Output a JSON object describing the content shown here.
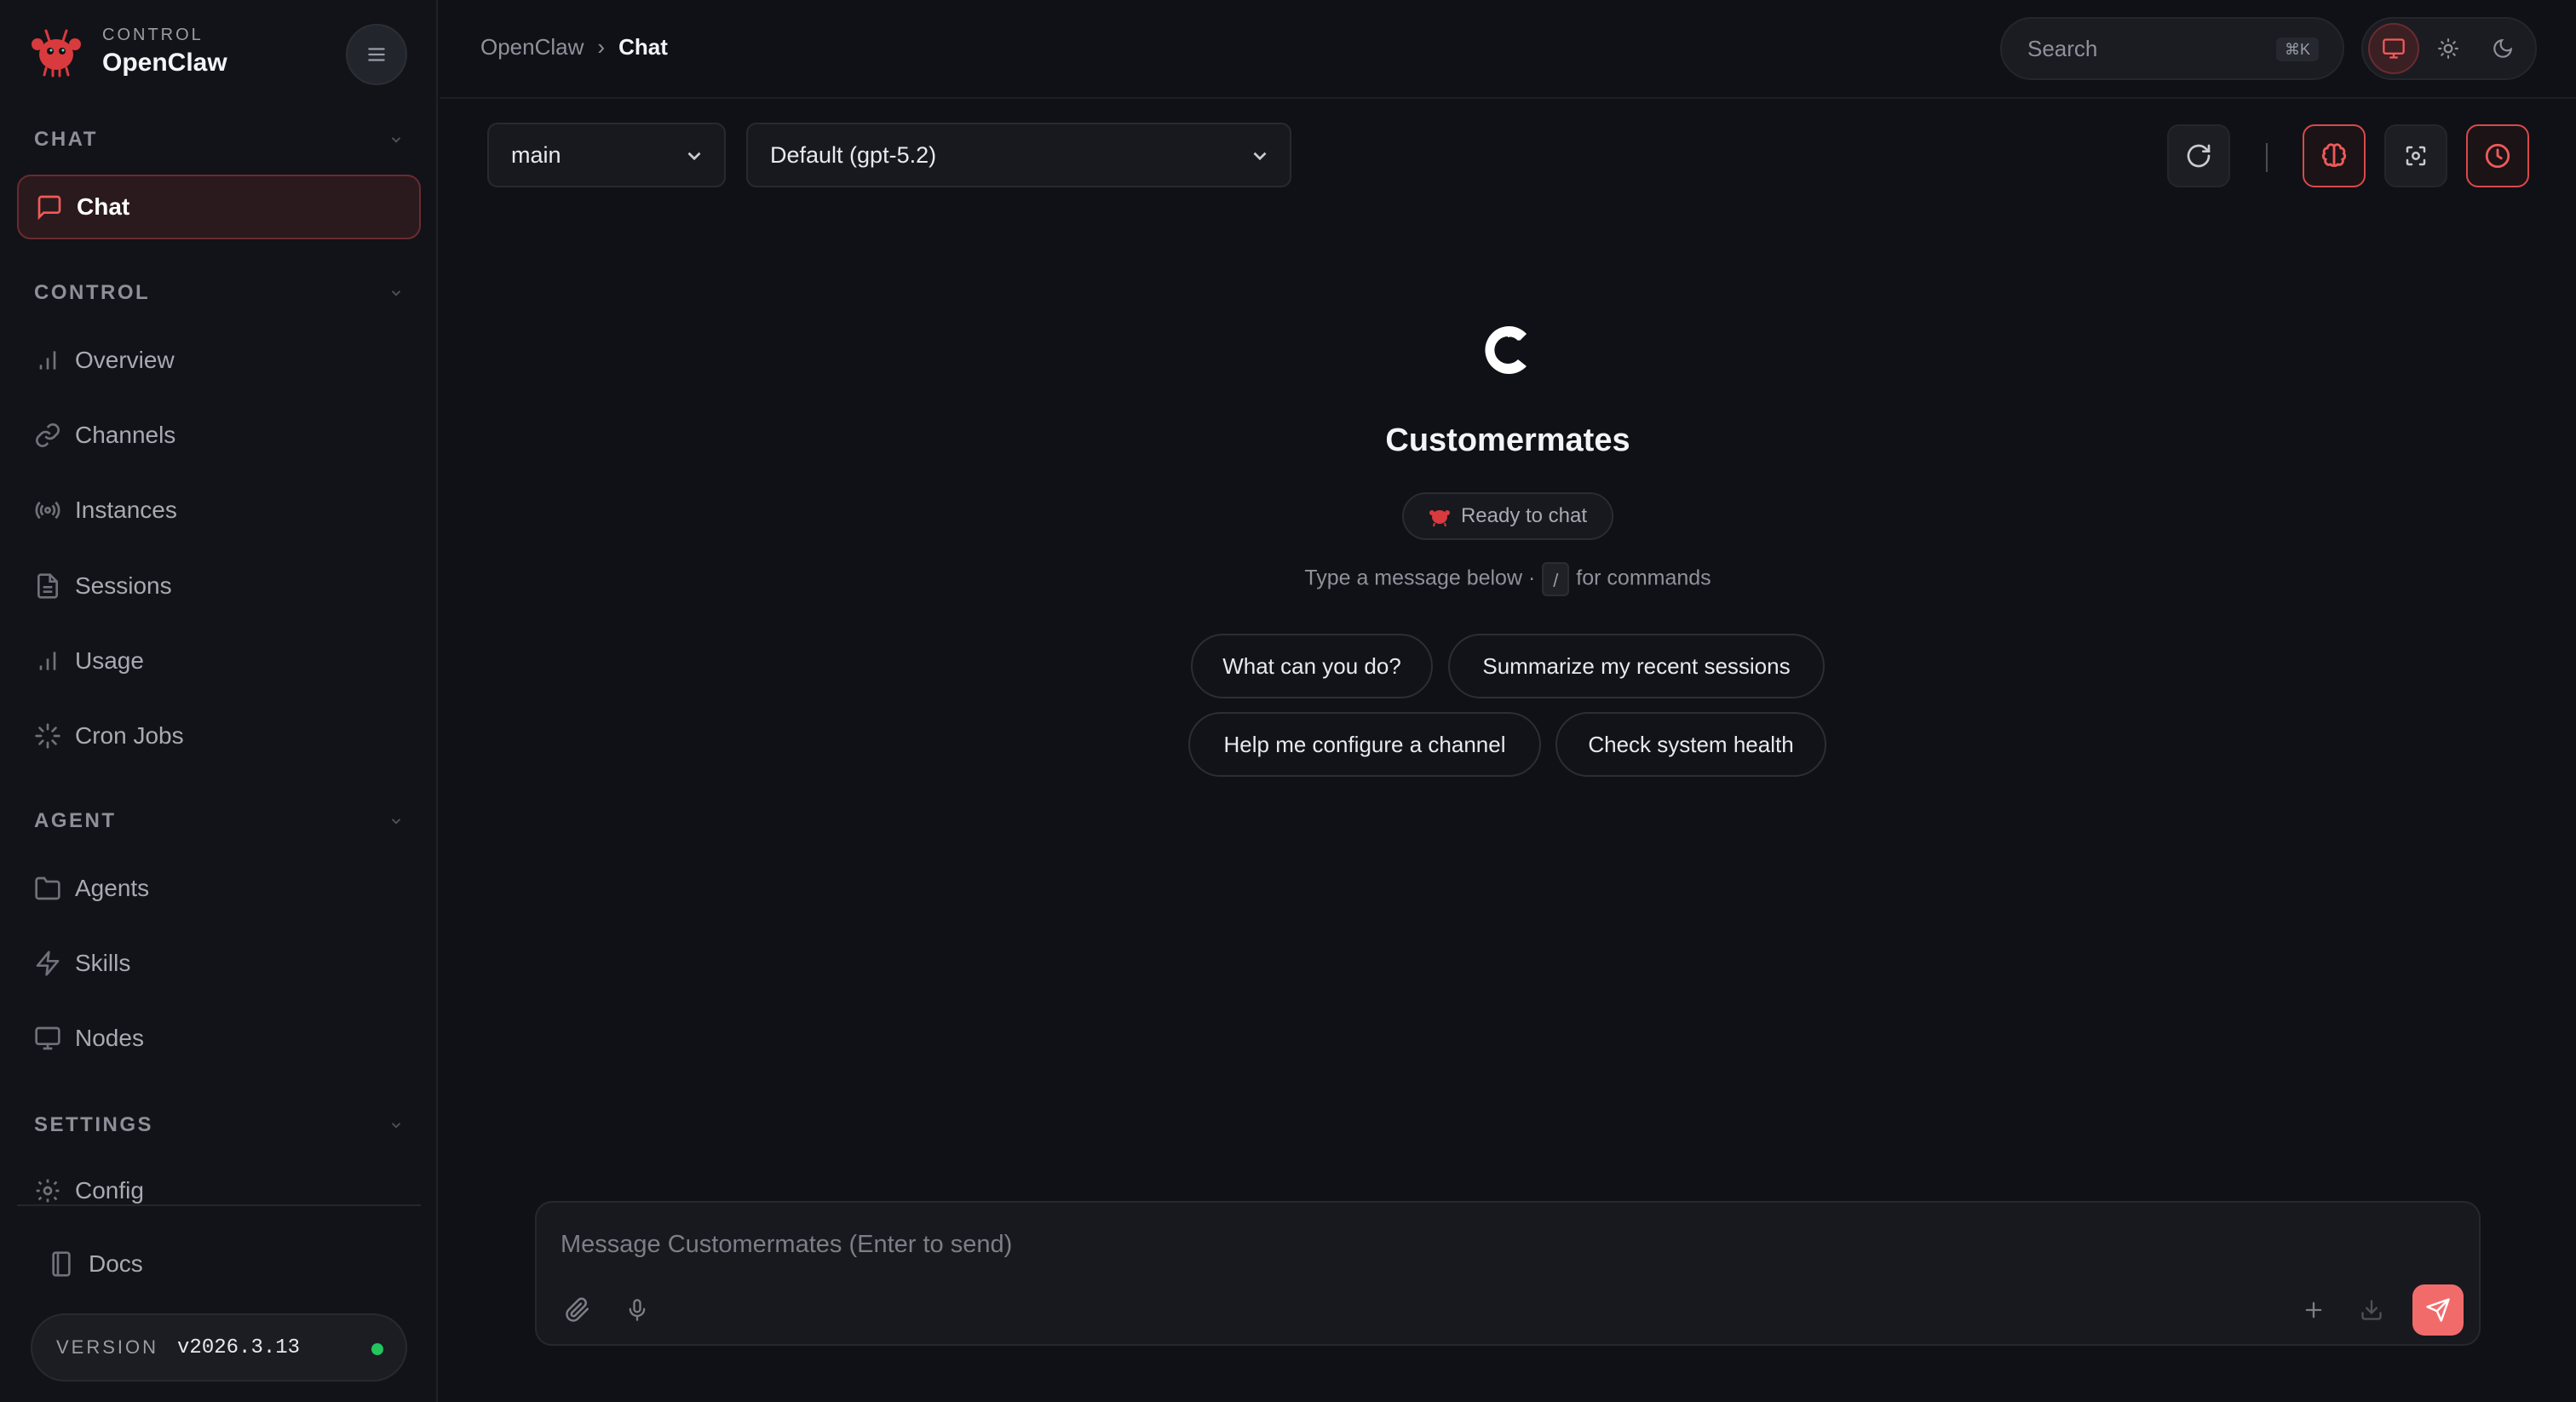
{
  "brand": {
    "subtitle": "CONTROL",
    "name": "OpenClaw"
  },
  "sidebar": {
    "sections": [
      {
        "title": "CHAT",
        "items": [
          {
            "label": "Chat",
            "icon": "message-square-icon",
            "active": true
          }
        ]
      },
      {
        "title": "CONTROL",
        "items": [
          {
            "label": "Overview",
            "icon": "bar-chart-icon"
          },
          {
            "label": "Channels",
            "icon": "link-icon"
          },
          {
            "label": "Instances",
            "icon": "radio-icon"
          },
          {
            "label": "Sessions",
            "icon": "file-text-icon"
          },
          {
            "label": "Usage",
            "icon": "bar-chart-icon"
          },
          {
            "label": "Cron Jobs",
            "icon": "loader-icon"
          }
        ]
      },
      {
        "title": "AGENT",
        "items": [
          {
            "label": "Agents",
            "icon": "folder-icon"
          },
          {
            "label": "Skills",
            "icon": "zap-icon"
          },
          {
            "label": "Nodes",
            "icon": "monitor-icon"
          }
        ]
      },
      {
        "title": "SETTINGS",
        "items": [
          {
            "label": "Config",
            "icon": "gear-icon"
          }
        ]
      }
    ],
    "docs": {
      "label": "Docs",
      "icon": "book-icon"
    },
    "version": {
      "label": "VERSION",
      "value": "v2026.3.13",
      "status_color": "#22c55e"
    }
  },
  "topbar": {
    "breadcrumb": {
      "root": "OpenClaw",
      "separator": "›",
      "current": "Chat"
    },
    "search": {
      "placeholder": "Search",
      "shortcut": "⌘K"
    },
    "theme_modes": [
      "monitor-icon",
      "sun-icon",
      "moon-icon"
    ]
  },
  "toolbar": {
    "session_select": "main",
    "model_select": "Default (gpt-5.2)"
  },
  "welcome": {
    "title": "Customermates",
    "status": "Ready to chat",
    "hint_before": "Type a message below ·",
    "hint_key": "/",
    "hint_after": "for commands",
    "suggestions": [
      "What can you do?",
      "Summarize my recent sessions",
      "Help me configure a channel",
      "Check system health"
    ]
  },
  "composer": {
    "placeholder": "Message Customermates (Enter to send)"
  },
  "colors": {
    "accent": "#ef5a5a",
    "send": "#f26b6b",
    "background": "#101116"
  }
}
